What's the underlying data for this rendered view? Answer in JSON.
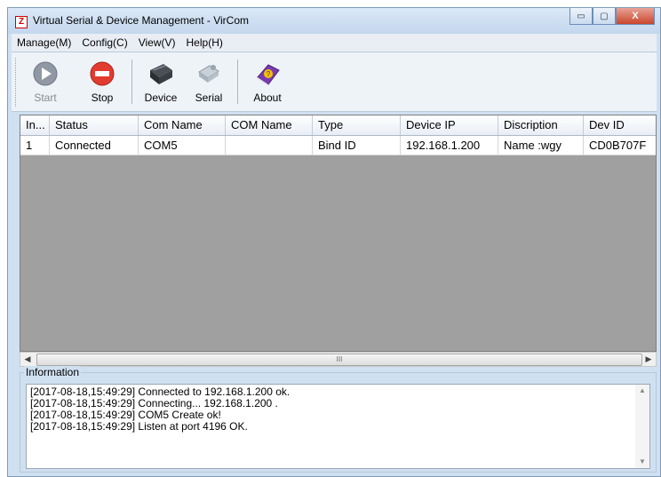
{
  "window": {
    "title": "Virtual Serial & Device Management - VirCom",
    "app_icon": "Z"
  },
  "window_buttons": {
    "minimize": "▭",
    "maximize": "▢",
    "close": "X"
  },
  "menu": [
    "Manage(M)",
    "Config(C)",
    "View(V)",
    "Help(H)"
  ],
  "toolbar": [
    {
      "label": "Start",
      "icon": "play-icon",
      "enabled": false
    },
    {
      "label": "Stop",
      "icon": "stop-icon",
      "enabled": true
    },
    {
      "label": "Device",
      "icon": "device-icon",
      "enabled": true
    },
    {
      "label": "Serial",
      "icon": "serial-icon",
      "enabled": true
    },
    {
      "label": "About",
      "icon": "about-book-icon",
      "enabled": true
    }
  ],
  "table": {
    "columns": [
      "In...",
      "Status",
      "Com Name",
      "COM Name",
      "Type",
      "Device IP",
      "Discription",
      "Dev ID"
    ],
    "rows": [
      [
        "1",
        "Connected",
        "COM5",
        "",
        "Bind ID",
        "192.168.1.200",
        "Name :wgy",
        "CD0B707F"
      ]
    ]
  },
  "scrollbar": {
    "grip": "III"
  },
  "info": {
    "label": "Information",
    "lines": [
      "[2017-08-18,15:49:29] Connected to 192.168.1.200 ok.",
      "[2017-08-18,15:49:29] Connecting... 192.168.1.200 .",
      "[2017-08-18,15:49:29] COM5 Create ok!",
      "[2017-08-18,15:49:29] Listen at port 4196 OK."
    ]
  },
  "colors": {
    "accent": "#cfe0f1",
    "close": "#c9462c",
    "stop": "#e23b2f"
  }
}
